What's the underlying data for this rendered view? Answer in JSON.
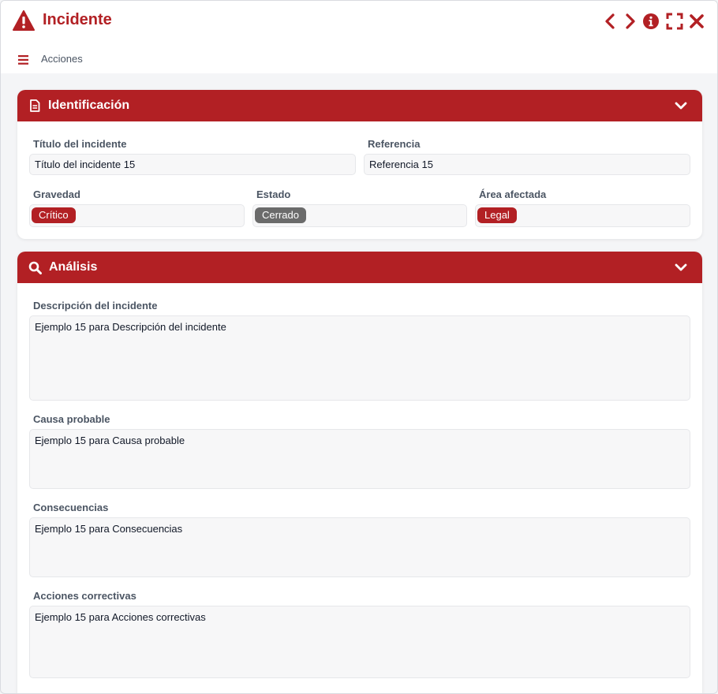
{
  "window": {
    "title": "Incidente",
    "menu_label": "Acciones",
    "accent": "#b22024",
    "icons": {
      "title": "warning-triangle-icon",
      "prev": "chevron-left-icon",
      "next": "chevron-right-icon",
      "info": "info-icon",
      "maximize": "maximize-icon",
      "close": "close-icon",
      "menu": "hamburger-icon"
    }
  },
  "identificacion": {
    "title": "Identificación",
    "icon": "document-icon",
    "fields": {
      "titulo": {
        "label": "Título del incidente",
        "value": "Título del incidente 15"
      },
      "referencia": {
        "label": "Referencia",
        "value": "Referencia 15"
      },
      "gravedad": {
        "label": "Gravedad",
        "value": "Crítico",
        "color": "#b22024"
      },
      "estado": {
        "label": "Estado",
        "value": "Cerrado",
        "color": "#6b6b6b"
      },
      "area": {
        "label": "Área afectada",
        "value": "Legal",
        "color": "#b22024"
      }
    }
  },
  "analisis": {
    "title": "Análisis",
    "icon": "search-icon",
    "fields": {
      "descripcion": {
        "label": "Descripción del incidente",
        "value": "Ejemplo 15 para Descripción del incidente"
      },
      "causa": {
        "label": "Causa probable",
        "value": "Ejemplo 15 para Causa probable"
      },
      "consecuencias": {
        "label": "Consecuencias",
        "value": "Ejemplo 15 para Consecuencias"
      },
      "acciones": {
        "label": "Acciones correctivas",
        "value": "Ejemplo 15 para Acciones correctivas"
      }
    }
  }
}
